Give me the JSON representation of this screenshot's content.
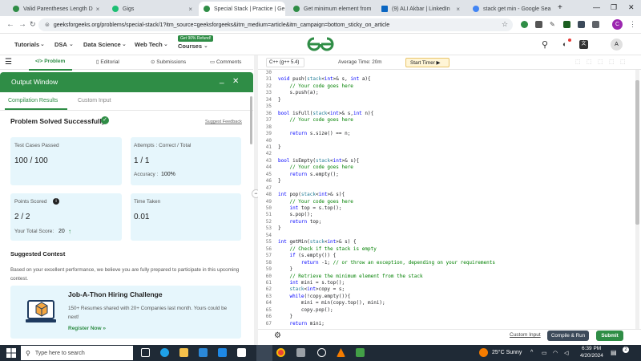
{
  "browser": {
    "tabs": [
      {
        "title": "Valid Parentheses Length D",
        "color": "#2f8d46"
      },
      {
        "title": "Gigs",
        "color": "#1dbf73"
      },
      {
        "title": "Special Stack | Practice | Ge",
        "color": "#2f8d46"
      },
      {
        "title": "Get minimum element from",
        "color": "#2f8d46"
      },
      {
        "title": "(9) ALI Akbar | LinkedIn",
        "color": "#0a66c2"
      },
      {
        "title": "stack get min - Google Sea",
        "color": "#4285f4"
      }
    ],
    "url": "geeksforgeeks.org/problems/special-stack/1?itm_source=geeksforgeeks&itm_medium=article&itm_campaign=bottom_sticky_on_article",
    "new_tab": "+",
    "win_min": "—",
    "win_max": "❐",
    "win_close": "✕",
    "profile_initial": "C"
  },
  "site_nav": {
    "items": [
      "Tutorials",
      "DSA",
      "Data Science",
      "Web Tech",
      "Courses"
    ],
    "badge": "Get 90% Refund!",
    "user_initial": "A"
  },
  "problem_tabs": {
    "problem": "Problem",
    "editorial": "Editorial",
    "submissions": "Submissions",
    "comments": "Comments"
  },
  "output": {
    "title": "Output Window",
    "tab_results": "Compilation Results",
    "tab_custom": "Custom Input",
    "status": "Problem Solved Successfully",
    "suggest": "Suggest Feedback",
    "tests_label": "Test Cases Passed",
    "tests_value": "100 / 100",
    "attempts_label": "Attempts : Correct / Total",
    "attempts_value": "1 / 1",
    "accuracy_label": "Accuracy :",
    "accuracy_value": "100%",
    "points_label": "Points Scored",
    "points_value": "2 / 2",
    "total_label": "Your Total Score:",
    "total_value": "20",
    "time_label": "Time Taken",
    "time_value": "0.01",
    "contest_heading": "Suggested Contest",
    "contest_desc": "Based on your excellent performance, we believe you are fully prepared to participate in this upcoming contest.",
    "contest_title": "Job-A-Thon Hiring Challenge",
    "contest_body": "150+ Resumes shared with 20+ Companies last month. Yours could be next!",
    "register": "Register Now »"
  },
  "editor": {
    "language": "C++ (g++ 5.4)",
    "avg_time": "Average Time: 20m",
    "timer": "Start Timer",
    "lines": [
      {
        "n": "30",
        "code": ""
      },
      {
        "n": "31",
        "code": "void push(stack<int>& s, int a){"
      },
      {
        "n": "32",
        "code": "    // Your code goes here"
      },
      {
        "n": "33",
        "code": "    s.push(a);"
      },
      {
        "n": "34",
        "code": "}"
      },
      {
        "n": "35",
        "code": ""
      },
      {
        "n": "36",
        "code": "bool isFull(stack<int>& s,int n){"
      },
      {
        "n": "37",
        "code": "    // Your code goes here"
      },
      {
        "n": "38",
        "code": ""
      },
      {
        "n": "39",
        "code": "    return s.size() == n;"
      },
      {
        "n": "40",
        "code": ""
      },
      {
        "n": "41",
        "code": "}"
      },
      {
        "n": "42",
        "code": ""
      },
      {
        "n": "43",
        "code": "bool isEmpty(stack<int>& s){"
      },
      {
        "n": "44",
        "code": "    // Your code goes here"
      },
      {
        "n": "45",
        "code": "    return s.empty();"
      },
      {
        "n": "46",
        "code": "}"
      },
      {
        "n": "47",
        "code": ""
      },
      {
        "n": "48",
        "code": "int pop(stack<int>& s){"
      },
      {
        "n": "49",
        "code": "    // Your code goes here"
      },
      {
        "n": "50",
        "code": "    int top = s.top();"
      },
      {
        "n": "51",
        "code": "    s.pop();"
      },
      {
        "n": "52",
        "code": "    return top;"
      },
      {
        "n": "53",
        "code": "}"
      },
      {
        "n": "54",
        "code": ""
      },
      {
        "n": "55",
        "code": "int getMin(stack<int>& s) {"
      },
      {
        "n": "56",
        "code": "    // Check if the stack is empty"
      },
      {
        "n": "57",
        "code": "    if (s.empty()) {"
      },
      {
        "n": "58",
        "code": "        return -1; // or throw an exception, depending on your requirements"
      },
      {
        "n": "59",
        "code": "    }"
      },
      {
        "n": "60",
        "code": "    // Retrieve the minimum element from the stack"
      },
      {
        "n": "61",
        "code": "    int mini = s.top();"
      },
      {
        "n": "62",
        "code": "    stack<int>copy = s;"
      },
      {
        "n": "63",
        "code": "    while(!copy.empty()){"
      },
      {
        "n": "64",
        "code": "        mini = min(copy.top(), mini);"
      },
      {
        "n": "65",
        "code": "        copy.pop();"
      },
      {
        "n": "66",
        "code": "    }"
      },
      {
        "n": "67",
        "code": "    return mini;"
      }
    ],
    "custom_input": "Custom Input",
    "compile_run": "Compile & Run",
    "submit": "Submit"
  },
  "taskbar": {
    "search": "Type here to search",
    "weather": "25°C  Sunny",
    "time": "6:39 PM",
    "date": "4/20/2024"
  },
  "colors": {
    "brand": "#2f8d46",
    "card": "#e6f6fc",
    "keyword": "#0000ff",
    "comment": "#008000",
    "type": "#267f99"
  }
}
